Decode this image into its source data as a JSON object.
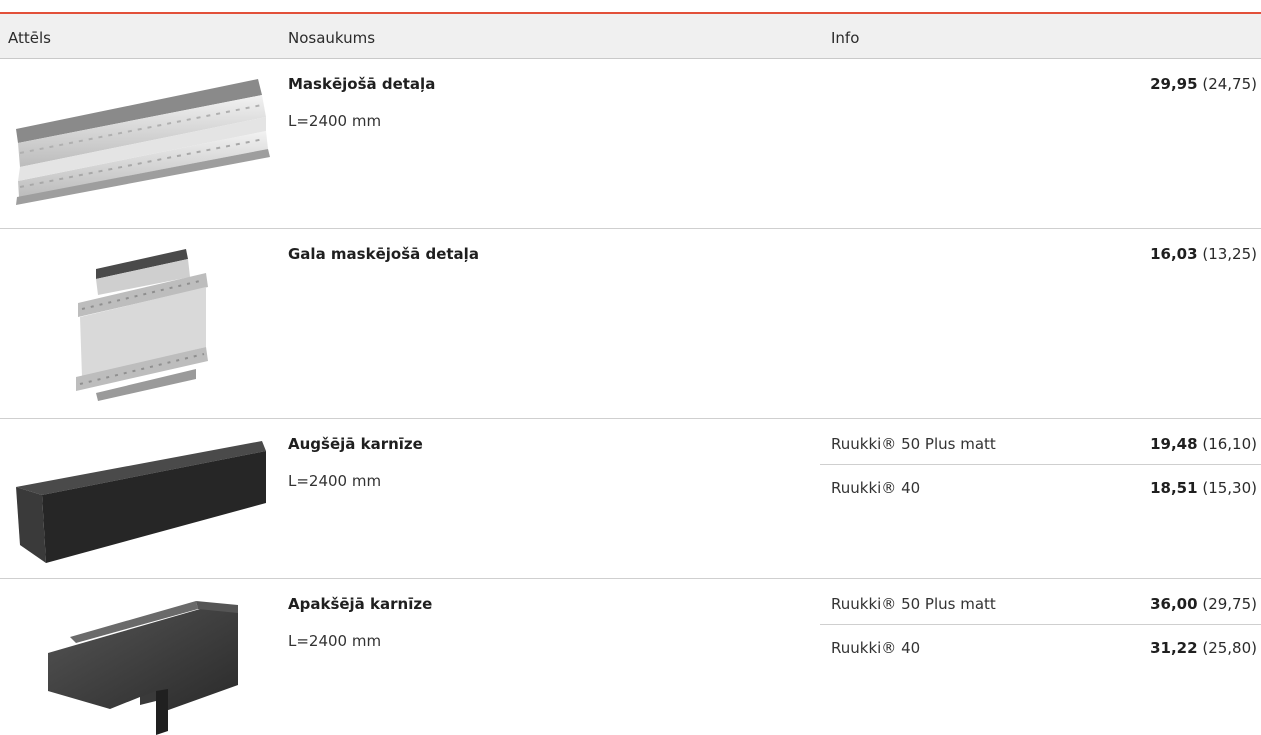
{
  "header": {
    "col_image": "Attēls",
    "col_name": "Nosaukums",
    "col_info": "Info"
  },
  "colors": {
    "accent": "#e2503a",
    "header_bg": "#f0f0f0",
    "divider": "#cfcfcf"
  },
  "rows": [
    {
      "name": "Maskējošā detaļa",
      "length": "L=2400 mm",
      "image": "masking-profile-image",
      "variants": [
        {
          "info": "",
          "price": "29,95",
          "price_net": "(24,75)"
        }
      ]
    },
    {
      "name": "Gala maskējošā detaļa",
      "length": "",
      "image": "end-masking-profile-image",
      "variants": [
        {
          "info": "",
          "price": "16,03",
          "price_net": "(13,25)"
        }
      ]
    },
    {
      "name": "Augšējā karnīze",
      "length": "L=2400 mm",
      "image": "upper-eave-image",
      "variants": [
        {
          "info": "Ruukki® 50 Plus matt",
          "price": "19,48",
          "price_net": "(16,10)"
        },
        {
          "info": "Ruukki® 40",
          "price": "18,51",
          "price_net": "(15,30)"
        }
      ]
    },
    {
      "name": "Apakšējā karnīze",
      "length": "L=2400 mm",
      "image": "lower-eave-image",
      "variants": [
        {
          "info": "Ruukki® 50 Plus matt",
          "price": "36,00",
          "price_net": "(29,75)"
        },
        {
          "info": "Ruukki® 40",
          "price": "31,22",
          "price_net": "(25,80)"
        }
      ]
    }
  ]
}
